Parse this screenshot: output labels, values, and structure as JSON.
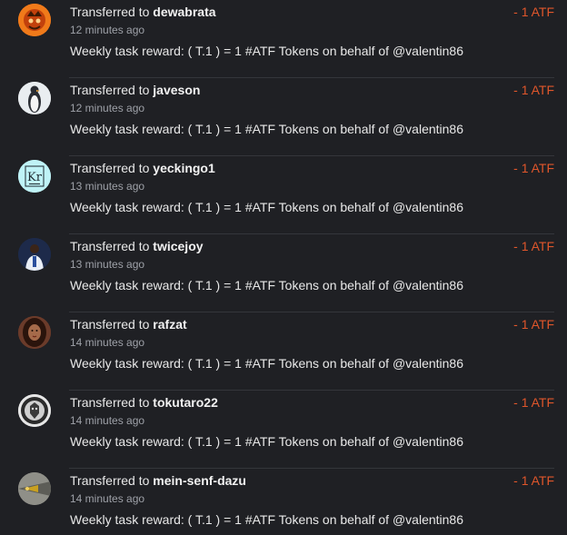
{
  "colors": {
    "background": "#1f2024",
    "text": "#e8e8e8",
    "muted": "#9ea1a8",
    "amount": "#e0562b",
    "divider": "#34363b"
  },
  "transfers": [
    {
      "prefix": "Transferred to",
      "username": "dewabrata",
      "time": "12 minutes ago",
      "memo": "Weekly task reward: ( T.1 ) = 1 #ATF Tokens on behalf of @valentin86",
      "amount": "- 1 ATF",
      "avatar_icon": "orange-emblem-avatar"
    },
    {
      "prefix": "Transferred to",
      "username": "javeson",
      "time": "12 minutes ago",
      "memo": "Weekly task reward: ( T.1 ) = 1 #ATF Tokens on behalf of @valentin86",
      "amount": "- 1 ATF",
      "avatar_icon": "penguin-avatar"
    },
    {
      "prefix": "Transferred to",
      "username": "yeckingo1",
      "time": "13 minutes ago",
      "memo": "Weekly task reward: ( T.1 ) = 1 #ATF Tokens on behalf of @valentin86",
      "amount": "- 1 ATF",
      "avatar_icon": "krypton-element-avatar",
      "avatar_text": "Kr"
    },
    {
      "prefix": "Transferred to",
      "username": "twicejoy",
      "time": "13 minutes ago",
      "memo": "Weekly task reward: ( T.1 ) = 1 #ATF Tokens on behalf of @valentin86",
      "amount": "- 1 ATF",
      "avatar_icon": "person-avatar"
    },
    {
      "prefix": "Transferred to",
      "username": "rafzat",
      "time": "14 minutes ago",
      "memo": "Weekly task reward: ( T.1 ) = 1 #ATF Tokens on behalf of @valentin86",
      "amount": "- 1 ATF",
      "avatar_icon": "portrait-avatar"
    },
    {
      "prefix": "Transferred to",
      "username": "tokutaro22",
      "time": "14 minutes ago",
      "memo": "Weekly task reward: ( T.1 ) = 1 #ATF Tokens on behalf of @valentin86",
      "amount": "- 1 ATF",
      "avatar_icon": "lion-emblem-avatar"
    },
    {
      "prefix": "Transferred to",
      "username": "mein-senf-dazu",
      "time": "14 minutes ago",
      "memo": "Weekly task reward: ( T.1 ) = 1 #ATF Tokens on behalf of @valentin86",
      "amount": "- 1 ATF",
      "avatar_icon": "abstract-avatar"
    }
  ]
}
